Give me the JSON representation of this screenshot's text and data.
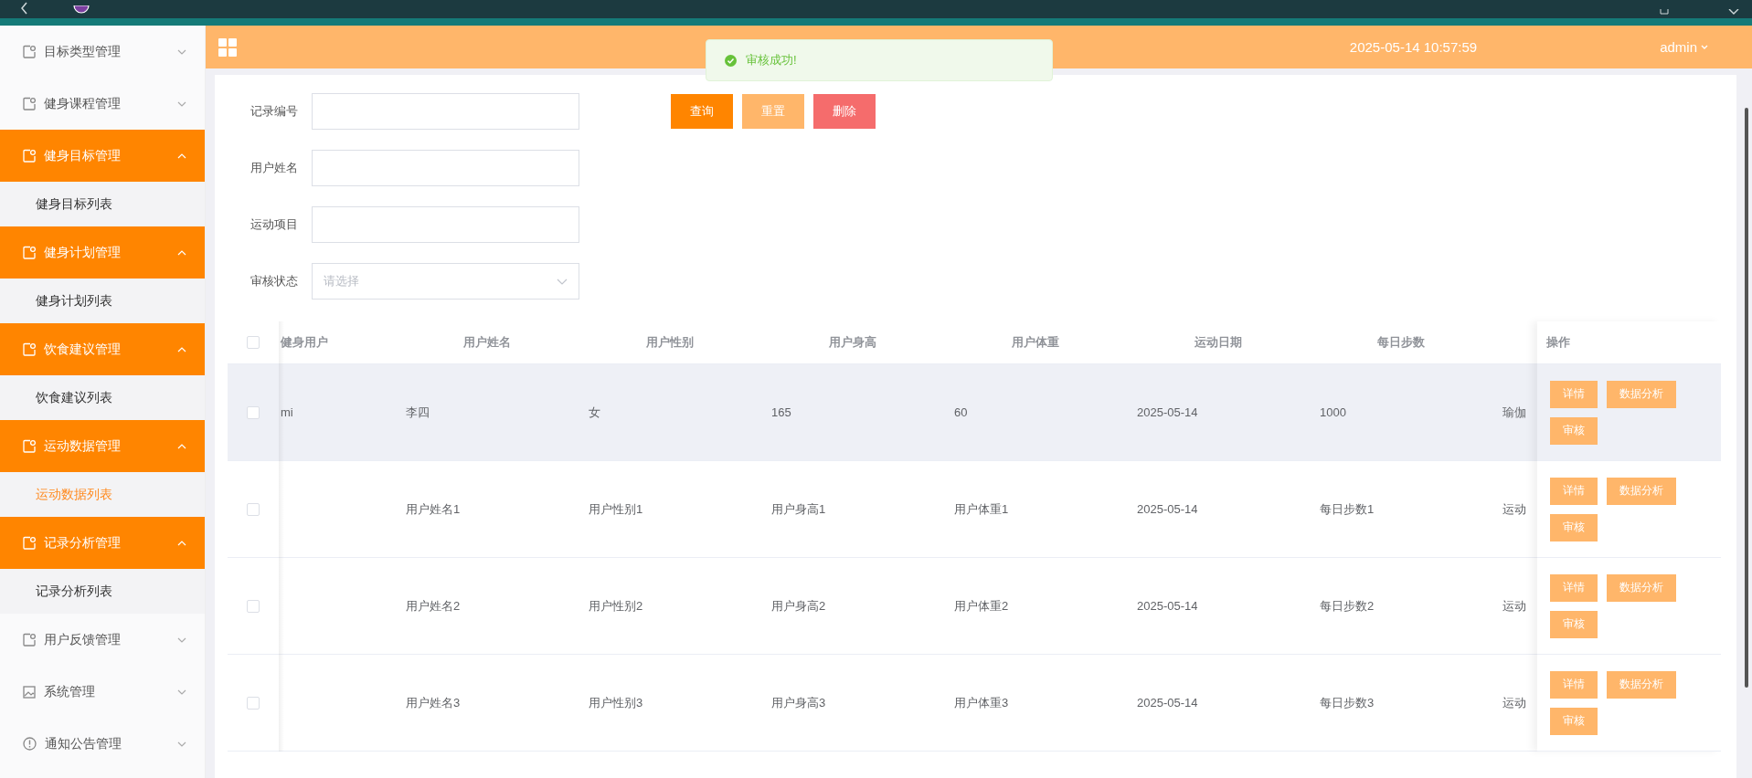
{
  "header": {
    "date": "2025-05-14 10:57:59",
    "user": "admin"
  },
  "toast": {
    "message": "审核成功!"
  },
  "sidebar": {
    "items": [
      {
        "label": "目标类型管理",
        "kind": "doc",
        "expanded": false
      },
      {
        "label": "健身课程管理",
        "kind": "doc",
        "expanded": false
      },
      {
        "label": "健身目标管理",
        "kind": "doc",
        "expanded": true,
        "children": [
          {
            "label": "健身目标列表",
            "selected": false
          }
        ]
      },
      {
        "label": "健身计划管理",
        "kind": "doc",
        "expanded": true,
        "children": [
          {
            "label": "健身计划列表",
            "selected": false
          }
        ]
      },
      {
        "label": "饮食建议管理",
        "kind": "doc",
        "expanded": true,
        "children": [
          {
            "label": "饮食建议列表",
            "selected": false
          }
        ]
      },
      {
        "label": "运动数据管理",
        "kind": "doc",
        "expanded": true,
        "children": [
          {
            "label": "运动数据列表",
            "selected": true
          }
        ]
      },
      {
        "label": "记录分析管理",
        "kind": "doc",
        "expanded": true,
        "children": [
          {
            "label": "记录分析列表",
            "selected": false
          }
        ]
      },
      {
        "label": "用户反馈管理",
        "kind": "doc",
        "expanded": false
      },
      {
        "label": "系统管理",
        "kind": "image",
        "expanded": false
      },
      {
        "label": "通知公告管理",
        "kind": "info",
        "expanded": false
      }
    ]
  },
  "form": {
    "fields": [
      {
        "label": "记录编号",
        "kind": "text"
      },
      {
        "label": "用户姓名",
        "kind": "text"
      },
      {
        "label": "运动项目",
        "kind": "text"
      },
      {
        "label": "审核状态",
        "kind": "select",
        "placeholder": "请选择"
      }
    ],
    "buttons": [
      {
        "label": "查询",
        "kind": "primary"
      },
      {
        "label": "重置",
        "kind": "warning"
      },
      {
        "label": "删除",
        "kind": "danger"
      }
    ]
  },
  "table": {
    "columns": [
      "健身用户",
      "用户姓名",
      "用户性别",
      "用户身高",
      "用户体重",
      "运动日期",
      "每日步数"
    ],
    "action_header": "操作",
    "all_checked": false,
    "rows": [
      {
        "highlighted": true,
        "checked": false,
        "cells": [
          "mi",
          "李四",
          "女",
          "165",
          "60",
          "2025-05-14",
          "1000",
          "瑜伽"
        ],
        "actions": [
          "详情",
          "数据分析",
          "审核"
        ]
      },
      {
        "highlighted": false,
        "checked": false,
        "cells": [
          "",
          "用户姓名1",
          "用户性别1",
          "用户身高1",
          "用户体重1",
          "2025-05-14",
          "每日步数1",
          "运动"
        ],
        "actions": [
          "详情",
          "数据分析",
          "审核"
        ]
      },
      {
        "highlighted": false,
        "checked": false,
        "cells": [
          "",
          "用户姓名2",
          "用户性别2",
          "用户身高2",
          "用户体重2",
          "2025-05-14",
          "每日步数2",
          "运动"
        ],
        "actions": [
          "详情",
          "数据分析",
          "审核"
        ]
      },
      {
        "highlighted": false,
        "checked": false,
        "cells": [
          "",
          "用户姓名3",
          "用户性别3",
          "用户身高3",
          "用户体重3",
          "2025-05-14",
          "每日步数3",
          "运动"
        ],
        "actions": [
          "详情",
          "数据分析",
          "审核"
        ]
      }
    ]
  }
}
